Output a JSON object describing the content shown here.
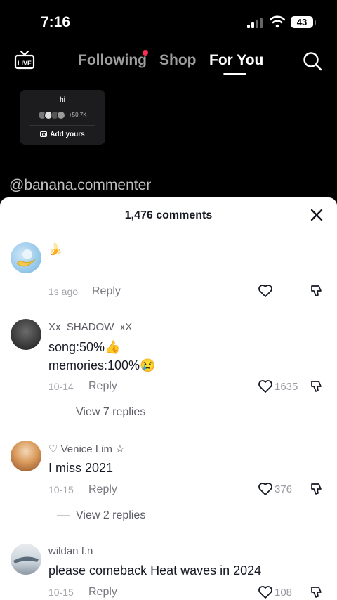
{
  "status": {
    "time": "7:16",
    "battery": "43"
  },
  "topnav": {
    "live": "LIVE",
    "tabs": [
      "Following",
      "Shop",
      "For You"
    ]
  },
  "sticker": {
    "title": "hi",
    "count": "+50.7K",
    "action": "Add yours"
  },
  "video_username": "@banana.commenter",
  "sheet": {
    "title": "1,476 comments"
  },
  "comments": [
    {
      "name": "",
      "text": "🍌",
      "text2": "",
      "date": "1s ago",
      "reply": "Reply",
      "likes": "",
      "view_replies": ""
    },
    {
      "name": "Xx_SHADOW_xX",
      "text": "song:50%👍",
      "text2": "memories:100%😢",
      "date": "10-14",
      "reply": "Reply",
      "likes": "1635",
      "view_replies": "View 7 replies"
    },
    {
      "name": "♡ Venice Lim ☆",
      "text": "I miss 2021",
      "text2": "",
      "date": "10-15",
      "reply": "Reply",
      "likes": "376",
      "view_replies": "View 2 replies"
    },
    {
      "name": "wildan f.n",
      "text": "please comeback Heat waves in 2024",
      "text2": "",
      "date": "10-15",
      "reply": "Reply",
      "likes": "108",
      "view_replies": ""
    }
  ],
  "colors": {
    "accent": "#fe2c55",
    "background": "#000000",
    "sheet": "#ffffff"
  }
}
